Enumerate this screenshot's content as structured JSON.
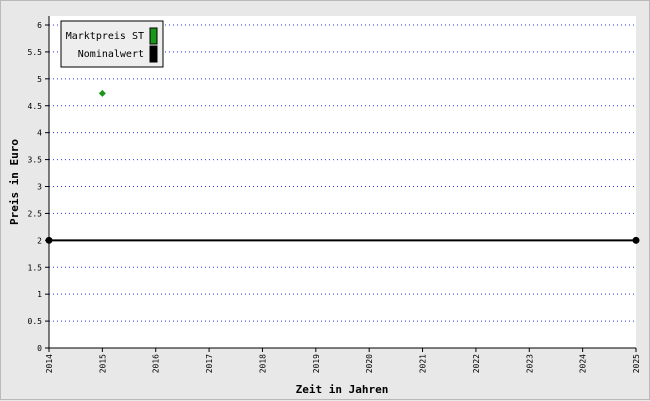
{
  "chart_data": {
    "type": "line",
    "xlabel": "Zeit in Jahren",
    "ylabel": "Preis in Euro",
    "xlim": [
      2014,
      2025
    ],
    "ylim": [
      0,
      6.2
    ],
    "x_ticks": [
      "2014",
      "2015",
      "2016",
      "2017",
      "2018",
      "2019",
      "2020",
      "2021",
      "2022",
      "2023",
      "2024",
      "2025"
    ],
    "y_ticks": [
      "0",
      "0.5",
      "1",
      "1.5",
      "2",
      "2.5",
      "3",
      "3.5",
      "4",
      "4.5",
      "5",
      "5.5",
      "6"
    ],
    "grid": true,
    "legend_position": "top-left",
    "series": [
      {
        "name": "Marktpreis ST",
        "kind": "scatter",
        "marker": "diamond",
        "color": "#1a961a",
        "points": [
          {
            "x": 2015,
            "y": 4.73
          }
        ]
      },
      {
        "name": "Nominalwert",
        "kind": "line",
        "marker": "circle",
        "color": "#000000",
        "points": [
          {
            "x": 2014,
            "y": 2
          },
          {
            "x": 2025,
            "y": 2
          }
        ]
      }
    ]
  }
}
